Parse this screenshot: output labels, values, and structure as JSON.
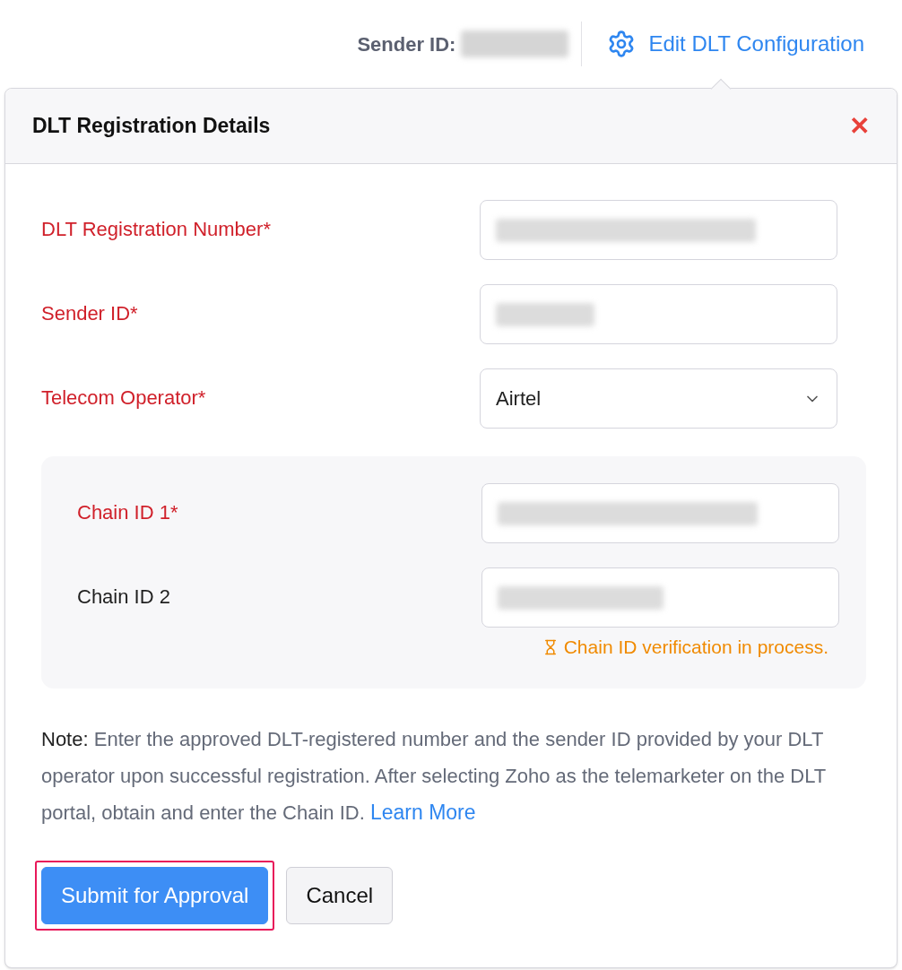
{
  "top_bar": {
    "sender_label": "Sender ID:",
    "edit_link": "Edit DLT Configuration"
  },
  "dialog": {
    "title": "DLT Registration Details",
    "close": "✕",
    "fields": [
      {
        "label": "DLT Registration Number*",
        "required": true,
        "kind": "redacted"
      },
      {
        "label": "Sender ID*",
        "required": true,
        "kind": "redacted"
      },
      {
        "label": "Telecom Operator*",
        "required": true,
        "kind": "select",
        "value": "Airtel"
      }
    ],
    "chain_fields": [
      {
        "label": "Chain ID 1*",
        "required": true,
        "kind": "redacted"
      },
      {
        "label": "Chain ID 2",
        "required": false,
        "kind": "redacted",
        "status": "Chain ID verification in process."
      }
    ],
    "note": {
      "lead": "Note:",
      "text": "Enter the approved DLT-registered number and the sender ID provided by your DLT operator upon successful registration. After selecting Zoho as the telemarketer on the DLT portal, obtain and enter the Chain ID.",
      "link": "Learn More"
    },
    "buttons": [
      {
        "label": "Submit for Approval",
        "kind": "primary",
        "focused": true
      },
      {
        "label": "Cancel",
        "kind": "secondary",
        "focused": false
      }
    ]
  }
}
